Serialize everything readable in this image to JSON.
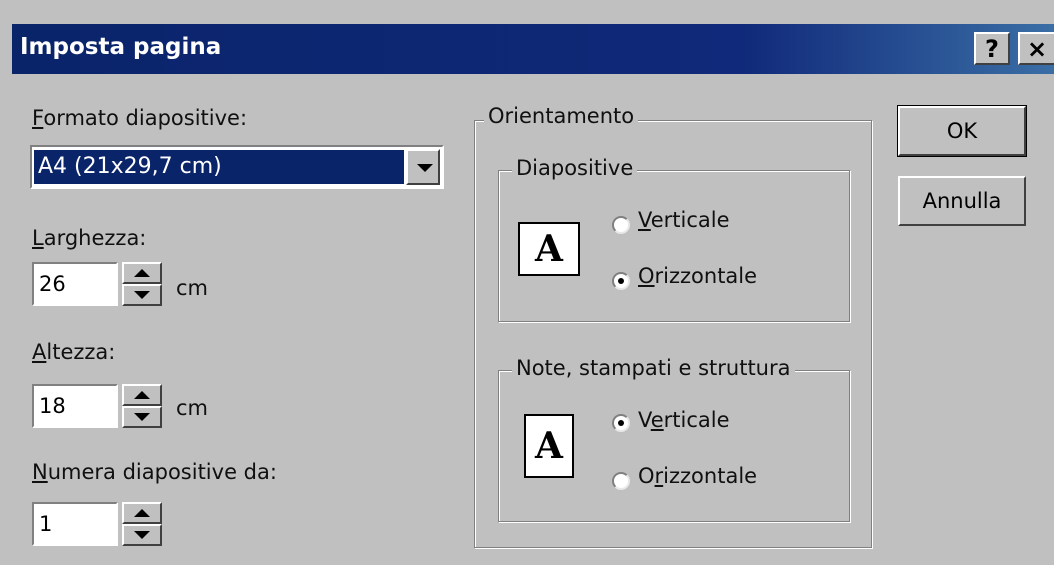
{
  "window": {
    "title": "Imposta pagina",
    "help_label": "?",
    "close_label": "×"
  },
  "format": {
    "label_accel": "F",
    "label_rest": "ormato diapositive:",
    "selected": "A4 (21x29,7 cm)"
  },
  "width": {
    "label_accel": "L",
    "label_rest": "arghezza:",
    "value": "26",
    "unit": "cm"
  },
  "height": {
    "label_accel": "A",
    "label_rest": "ltezza:",
    "value": "18",
    "unit": "cm"
  },
  "numbering": {
    "label_accel": "N",
    "label_rest": "umera diapositive da:",
    "value": "1"
  },
  "orientation": {
    "label": "Orientamento",
    "slides": {
      "label": "Diapositive",
      "icon_letter": "A",
      "vertical": {
        "pre": "",
        "accel": "V",
        "rest": "erticale",
        "checked": false
      },
      "horizontal": {
        "pre": "",
        "accel": "O",
        "rest": "rizzontale",
        "checked": true
      }
    },
    "notes": {
      "label": "Note, stampati e struttura",
      "icon_letter": "A",
      "vertical": {
        "pre": "V",
        "accel": "e",
        "rest": "rticale",
        "checked": true
      },
      "horizontal": {
        "pre": "O",
        "accel": "r",
        "rest": "izzontale",
        "checked": false
      }
    }
  },
  "buttons": {
    "ok": "OK",
    "cancel": "Annulla"
  }
}
